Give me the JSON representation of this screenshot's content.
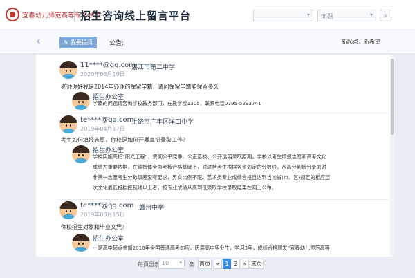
{
  "header": {
    "logo_text": "宜春幼儿师范高等专科学校",
    "title": "招生咨询线上留言平台",
    "select1": "",
    "select2": "问题",
    "search_icon": "search-icon"
  },
  "toolbar": {
    "back_icon": "back-arrow-icon",
    "ask_label": "我要提问",
    "notice_label": "公告:",
    "links": "新起点，新希望"
  },
  "posts": [
    {
      "user": "11****@qq.com",
      "school": "湛江市第二中学",
      "date": "2020年03月19日",
      "question": "老师你好我是2014年办理的保留学籍，请问保留学籍能保留多久",
      "reply_name": "招生办公室",
      "reply_lines": [
        "学籍的问题请咨询学校教务部门，在教学楼1305，联系电话0795-5293741"
      ]
    },
    {
      "user": "te****@qq.com",
      "school": "上饶市广丰区洋口中学",
      "date": "2019年04月17日",
      "question": "考生如何填报志愿，你校是如何开展高招录取工作？",
      "reply_name": "招生办公室",
      "reply_lines": [
        "学校实施高招“阳光工程”，贯彻公平竞争、公正选拔、公开透明录取原则。学校以考生填报志愿和高考文化",
        "成绩为重要依据，在德智体全面考核合格基础上，对进档考生根据各省划定的分数线，从高分到低分录取对",
        "非第一志愿考生分数级差没有要求，男女比例不限。艺术类专业成绩合格且达到当地省(市、区)规定的相应层",
        "次文化最低投档控制线以上者，按专业成绩从高到低录取学校录取结果在网上公布。"
      ]
    },
    {
      "user": "te****@qq.com",
      "school": "赣州中学",
      "date": "2019年03月15日",
      "question": "你校招生对象和毕业文凭？",
      "reply_name": "招生办公室",
      "reply_lines": [
        "一是高中起点参加2018年全国普通高考的应、历届高中毕业生，学习3年，成绩合格颁发“宜春幼儿师范高等"
      ]
    }
  ],
  "pager": {
    "per_page_label": "每页显示",
    "per_page_value": "10",
    "unit": "条",
    "first": "首页",
    "prev": "«",
    "page1": "1",
    "page2": "2",
    "next": "»",
    "last": "末页"
  }
}
